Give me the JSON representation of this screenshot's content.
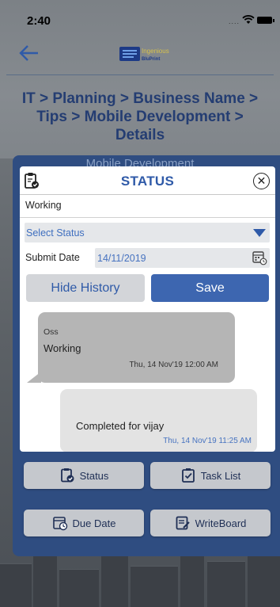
{
  "status_bar": {
    "time": "2:40"
  },
  "header": {
    "back_icon": "arrow-left-icon",
    "logo_text_top": "Ingenious",
    "logo_text_bottom": "BluPrint"
  },
  "breadcrumb": "IT > Planning > Business Name > Tips > Mobile Development > Details",
  "ghost_title": "Mobile Development",
  "dialog": {
    "title": "STATUS",
    "status_value": "Working",
    "select_placeholder": "Select Status",
    "submit_label": "Submit Date",
    "submit_date": "14/11/2019",
    "hide_history_label": "Hide History",
    "save_label": "Save",
    "history": [
      {
        "author": "Oss",
        "text": "Working",
        "time": "Thu, 14 Nov'19 12:00 AM"
      },
      {
        "author": "",
        "text": "Completed for vijay",
        "time": "Thu, 14 Nov'19 11:25 AM"
      }
    ]
  },
  "actions": {
    "status": "Status",
    "task_list": "Task List",
    "due_date": "Due Date",
    "writeboard": "WriteBoard"
  },
  "colors": {
    "primary": "#2f5aa8",
    "card": "#2f4d81",
    "title_text": "#243d72"
  }
}
